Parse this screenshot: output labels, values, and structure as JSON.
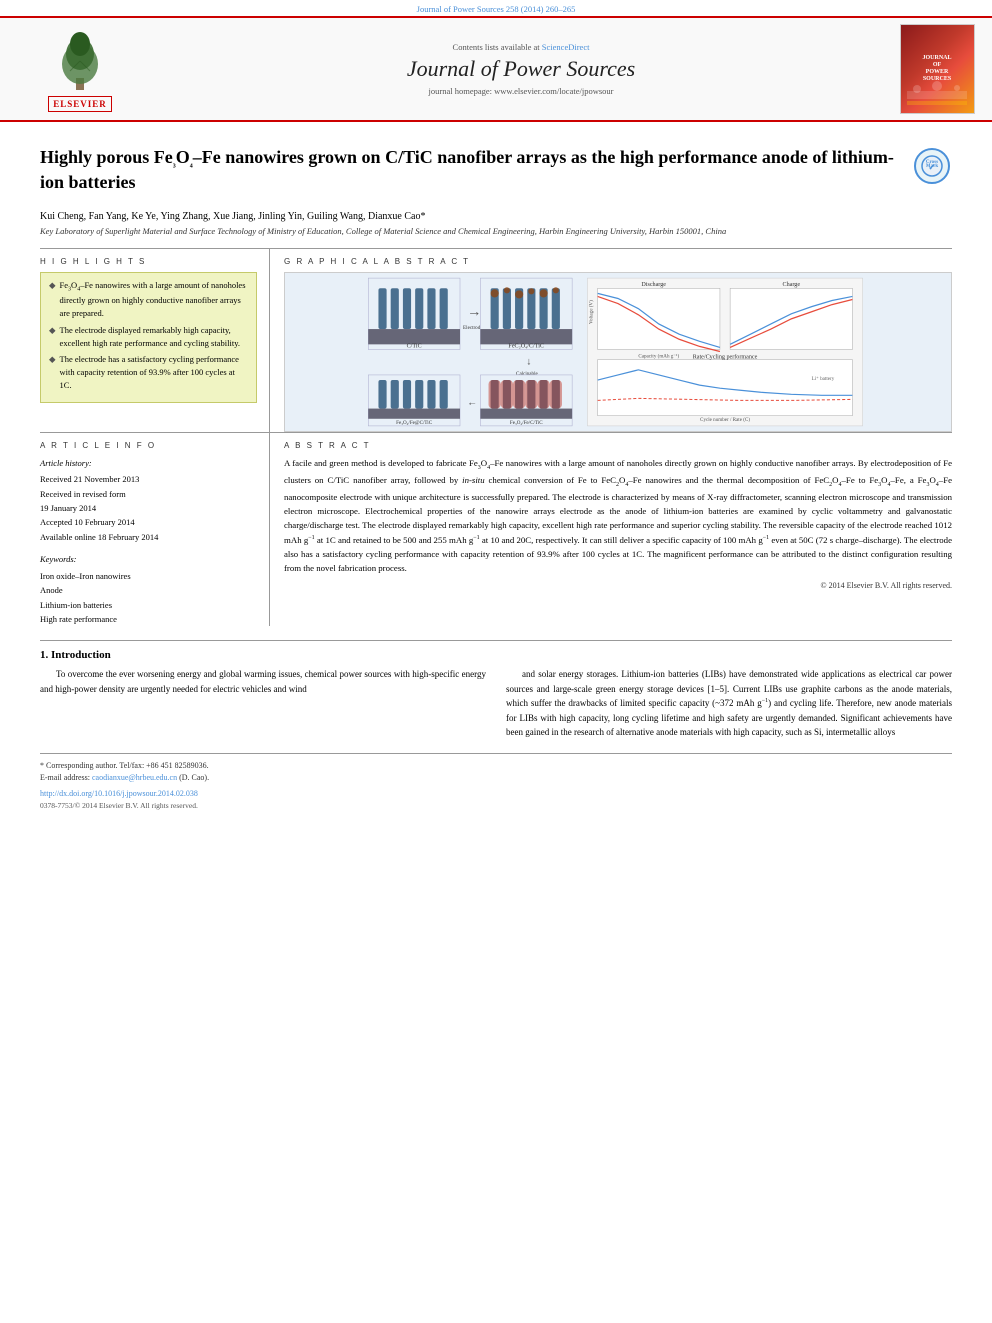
{
  "journal_ref": "Journal of Power Sources 258 (2014) 260–265",
  "header": {
    "science_direct_text": "Contents lists available at",
    "science_direct_link": "ScienceDirect",
    "journal_title": "Journal of Power Sources",
    "homepage_text": "journal homepage: www.elsevier.com/locate/jpowsour",
    "elsevier_label": "ELSEVIER"
  },
  "article": {
    "title": "Highly porous Fe₃O₄–Fe nanowires grown on C/TiC nanofiber arrays as the high performance anode of lithium-ion batteries",
    "authors": "Kui Cheng, Fan Yang, Ke Ye, Ying Zhang, Xue Jiang, Jinling Yin, Guiling Wang, Dianxue Cao*",
    "affiliation": "Key Laboratory of Superlight Material and Surface Technology of Ministry of Education, College of Material Science and Chemical Engineering, Harbin Engineering University, Harbin 150001, China"
  },
  "highlights": {
    "heading": "H I G H L I G H T S",
    "items": [
      "Fe₃O₄–Fe nanowires with a large amount of nanoholes directly grown on highly conductive nanofiber arrays are prepared.",
      "The electrode displayed remarkably high capacity, excellent high rate performance and cycling stability.",
      "The electrode has a satisfactory cycling performance with capacity retention of 93.9% after 100 cycles at 1C."
    ]
  },
  "graphical_abstract": {
    "heading": "G R A P H I C A L   A B S T R A C T"
  },
  "article_info": {
    "heading": "A R T I C L E   I N F O",
    "history_title": "Article history:",
    "received": "Received 21 November 2013",
    "revised": "Received in revised form 19 January 2014",
    "accepted": "Accepted 10 February 2014",
    "available": "Available online 18 February 2014",
    "keywords_title": "Keywords:",
    "keywords": [
      "Iron oxide–Iron nanowires",
      "Anode",
      "Lithium-ion batteries",
      "High rate performance"
    ]
  },
  "abstract": {
    "heading": "A B S T R A C T",
    "text": "A facile and green method is developed to fabricate Fe₃O₄–Fe nanowires with a large amount of nanoholes directly grown on highly conductive nanofiber arrays. By electrodeposition of Fe clusters on C/TiC nanofiber array, followed by in-situ chemical conversion of Fe to FeC₂O₄–Fe nanowires and the thermal decomposition of FeC₂O₄–Fe to Fe₃O₄–Fe, a Fe₃O₄–Fe nanocomposite electrode with unique architecture is successfully prepared. The electrode is characterized by means of X-ray diffractometer, scanning electron microscope and transmission electron microscope. Electrochemical properties of the nanowire arrays electrode as the anode of lithium-ion batteries are examined by cyclic voltammetry and galvanostatic charge/discharge test. The electrode displayed remarkably high capacity, excellent high rate performance and superior cycling stability. The reversible capacity of the electrode reached 1012 mAh g⁻¹ at 1C and retained to be 500 and 255 mAh g⁻¹ at 10 and 20C, respectively. It can still deliver a specific capacity of 100 mAh g⁻¹ even at 50C (72 s charge–discharge). The electrode also has a satisfactory cycling performance with capacity retention of 93.9% after 100 cycles at 1C. The magnificent performance can be attributed to the distinct configuration resulting from the novel fabrication process.",
    "copyright": "© 2014 Elsevier B.V. All rights reserved."
  },
  "introduction": {
    "heading": "1.  Introduction",
    "left_text": "To overcome the ever worsening energy and global warming issues, chemical power sources with high-specific energy and high-power density are urgently needed for electric vehicles and wind",
    "right_text": "and solar energy storages. Lithium-ion batteries (LIBs) have demonstrated wide applications as electrical car power sources and large-scale green energy storage devices [1–5]. Current LIBs use graphite carbons as the anode materials, which suffer the drawbacks of limited specific capacity (~372 mAh g⁻¹) and cycling life. Therefore, new anode materials for LIBs with high capacity, long cycling lifetime and high safety are urgently demanded. Significant achievements have been gained in the research of alternative anode materials with high capacity, such as Si, intermetallic alloys"
  },
  "footnotes": {
    "corresponding": "* Corresponding author. Tel/fax: +86 451 82589036.",
    "email_label": "E-mail address:",
    "email": "caodianxue@hrbeu.edu.cn",
    "email_suffix": "(D. Cao).",
    "doi": "http://dx.doi.org/10.1016/j.jpowsour.2014.02.038",
    "issn": "0378-7753/© 2014 Elsevier B.V. All rights reserved."
  }
}
